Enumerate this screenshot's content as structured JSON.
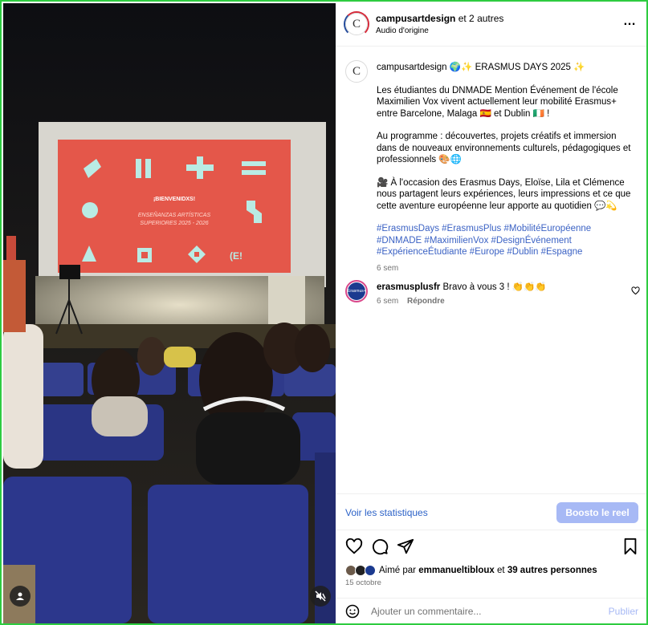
{
  "header": {
    "username": "campusartdesign",
    "coauthors": "et 2 autres",
    "audio": "Audio d'origine",
    "more": "…",
    "avatar_letter": "C"
  },
  "caption": {
    "avatar_letter": "C",
    "username": "campusartdesign",
    "title": "🌍✨ ERASMUS DAYS 2025 ✨",
    "p1": "Les étudiantes du DNMADE Mention Événement de l'école Maximilien Vox vivent actuellement leur mobilité Erasmus+ entre Barcelone, Malaga 🇪🇸 et Dublin 🇮🇪 !",
    "p2": "Au programme : découvertes, projets créatifs et immersion dans de nouveaux environnements culturels, pédagogiques et professionnels 🎨🌐",
    "p3": "🎥 À l'occasion des Erasmus Days, Eloïse, Lila et Clémence nous partagent leurs expériences, leurs impressions et ce que cette aventure européenne leur apporte au quotidien 💬💫",
    "hashtags": "#ErasmusDays #ErasmusPlus #MobilitéEuropéenne #DNMADE #MaximilienVox #DesignÉvénement #ExpérienceÉtudiante #Europe #Dublin #Espagne",
    "time": "6 sem"
  },
  "comment": {
    "avatar_label": "Erasmus+",
    "username": "erasmusplusfr",
    "text": "Bravo à vous 3 ! 👏👏👏",
    "time": "6 sem",
    "reply": "Répondre"
  },
  "stats": {
    "link": "Voir les statistiques",
    "boost": "Boosto le reel"
  },
  "likes": {
    "prefix": "Aimé par",
    "user": "emmanueltibloux",
    "suffix": "et",
    "others": "39 autres personnes"
  },
  "date": "15 octobre",
  "add_comment": {
    "placeholder": "Ajouter un commentaire...",
    "publish": "Publier"
  },
  "video_slide": {
    "welcome": "¡BIENVENIDXS!",
    "line1": "ENSEÑANZAS ARTÍSTICAS",
    "line2": "SUPERIORES 2025 - 2026",
    "logo_text": "(E!"
  },
  "colors": {
    "accent_blue": "#2d63c8",
    "boost_bg": "#a7b9f5",
    "slide_red": "#e4574a",
    "slide_mint": "#b9ebe4",
    "seat_blue": "#2f3a8a"
  },
  "icons": [
    "heart-icon",
    "comment-icon",
    "share-icon",
    "bookmark-icon",
    "emoji-icon",
    "more-icon",
    "user-icon",
    "muted-speaker-icon"
  ]
}
